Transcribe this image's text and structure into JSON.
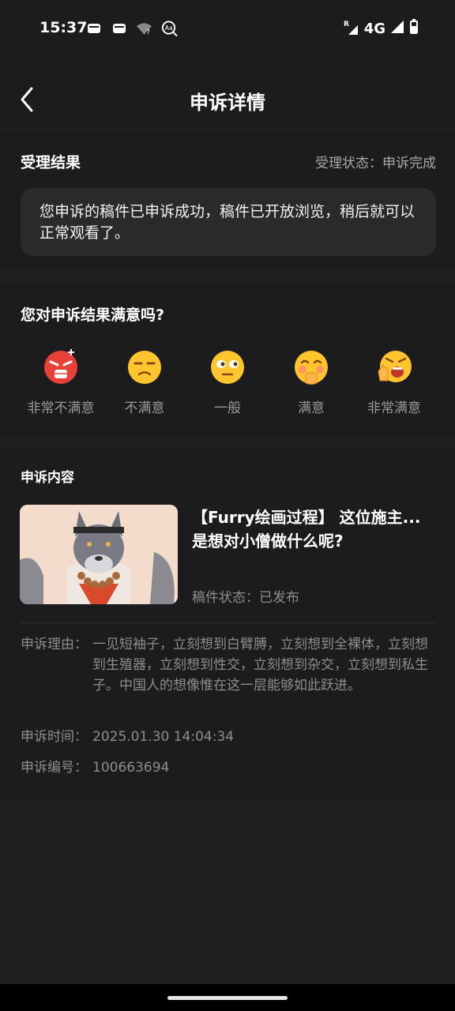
{
  "status_bar": {
    "time": "15:37",
    "left_icons": [
      "wallet-icon",
      "wallet-icon",
      "wifi-question-icon",
      "font-size-icon"
    ],
    "right_icons": [
      "roaming-signal-icon",
      "signal-icon",
      "battery-icon"
    ],
    "network": "4G"
  },
  "nav": {
    "title": "申诉详情"
  },
  "result": {
    "title": "受理结果",
    "status": "受理状态：申诉完成",
    "message": "您申诉的稿件已申诉成功，稿件已开放浏览，稍后就可以正常观看了。"
  },
  "survey": {
    "question": "您对申诉结果满意吗?",
    "options": [
      {
        "label": "非常不满意",
        "icon": "angry-emoji-icon"
      },
      {
        "label": "不满意",
        "icon": "unamused-emoji-icon"
      },
      {
        "label": "一般",
        "icon": "neutral-emoji-icon"
      },
      {
        "label": "满意",
        "icon": "pleased-emoji-icon"
      },
      {
        "label": "非常满意",
        "icon": "thumbs-up-emoji-icon"
      }
    ]
  },
  "appeal": {
    "section_title": "申诉内容",
    "post_title": "【Furry绘画过程】 这位施主...是想对小僧做什么呢?",
    "post_status": "稿件状态：已发布",
    "reason_label": "申诉理由：",
    "reason": "一见短袖子，立刻想到白臂膊，立刻想到全裸体，立刻想到生殖器，立刻想到性交，立刻想到杂交，立刻想到私生子。中国人的想像惟在这一层能够如此跃进。",
    "time_label": "申诉时间：",
    "time": "2025.01.30 14:04:34",
    "id_label": "申诉编号：",
    "id": "100663694"
  },
  "colors": {
    "background": "#1f1f21",
    "card": "#1c1c1e",
    "box": "#2a2a2c",
    "muted_text": "#8e8e90",
    "emoji_yellow": "#ffc52e",
    "emoji_red": "#e8413a"
  }
}
